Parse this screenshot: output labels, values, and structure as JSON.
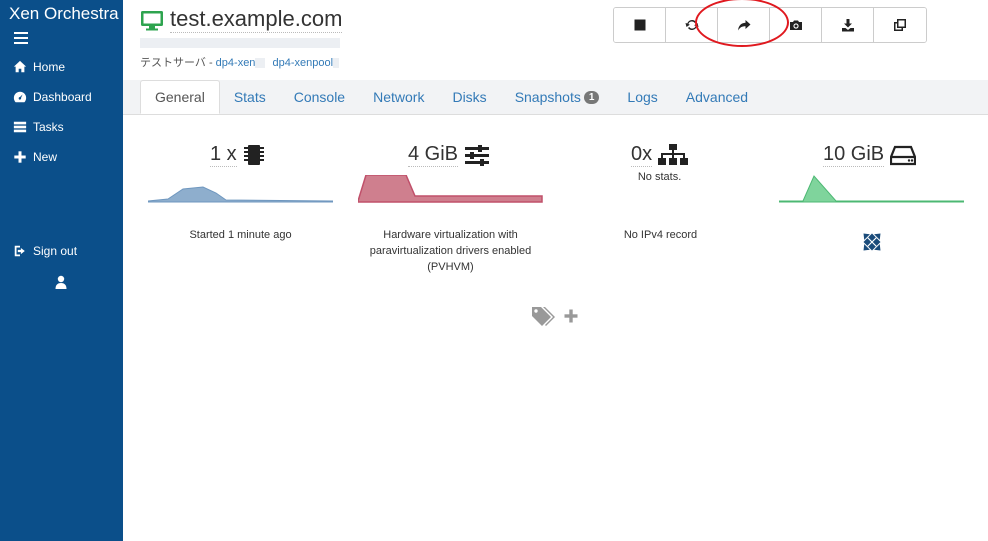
{
  "app": {
    "title": "Xen Orchestra"
  },
  "sidebar": {
    "items": [
      {
        "label": "Home",
        "icon": "home-icon"
      },
      {
        "label": "Dashboard",
        "icon": "dashboard-icon"
      },
      {
        "label": "Tasks",
        "icon": "tasks-icon"
      },
      {
        "label": "New",
        "icon": "plus-icon"
      }
    ],
    "sign_out": "Sign out"
  },
  "vm": {
    "name": "test.example.com",
    "path_prefix": "テストサーバ - ",
    "host": "dp4-xen",
    "pool": "dp4-xenpool",
    "status_color": "#2ea44f"
  },
  "toolbar": {
    "buttons": [
      "stop-icon",
      "restart-icon",
      "migrate-icon",
      "snapshot-icon",
      "export-icon",
      "copy-icon"
    ],
    "highlighted": "migrate-icon"
  },
  "tabs": [
    {
      "label": "General",
      "active": true
    },
    {
      "label": "Stats"
    },
    {
      "label": "Console"
    },
    {
      "label": "Network"
    },
    {
      "label": "Disks"
    },
    {
      "label": "Snapshots",
      "badge": "1"
    },
    {
      "label": "Logs"
    },
    {
      "label": "Advanced"
    }
  ],
  "stats": {
    "cpu": {
      "value": "1 x",
      "caption": "Started 1 minute ago",
      "color": "#7fa3c5"
    },
    "memory": {
      "value": "4 GiB",
      "caption": "Hardware virtualization with paravirtualization drivers enabled (PVHVM)",
      "color": "#c96b7d"
    },
    "network": {
      "value": "0x",
      "note": "No stats.",
      "caption": "No IPv4 record"
    },
    "disk": {
      "value": "10 GiB",
      "color": "#6ac28a"
    }
  }
}
